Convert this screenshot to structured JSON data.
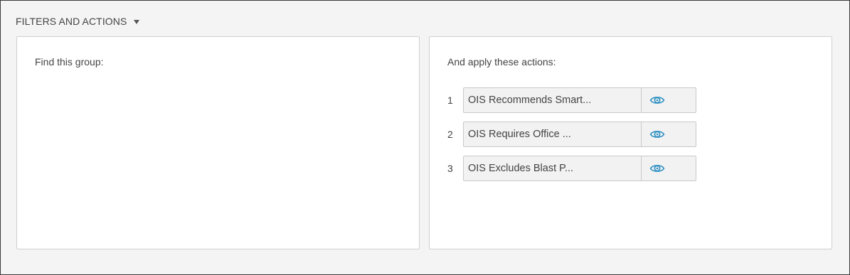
{
  "header": {
    "title": "FILTERS AND ACTIONS",
    "caret_icon": "caret-down-icon"
  },
  "find_panel": {
    "label": "Find this group:"
  },
  "actions_panel": {
    "label": "And apply these actions:",
    "items": [
      {
        "number": "1",
        "name": "OIS Recommends Smart...",
        "view_icon": "eye-icon"
      },
      {
        "number": "2",
        "name": "OIS Requires Office ...",
        "view_icon": "eye-icon"
      },
      {
        "number": "3",
        "name": "OIS Excludes Blast P...",
        "view_icon": "eye-icon"
      }
    ]
  },
  "colors": {
    "background": "#f4f4f4",
    "panel": "#ffffff",
    "panel_border": "#cfcfcf",
    "action_box": "#f2f2f2",
    "eye_icon": "#2b8fc2",
    "text": "#444444"
  }
}
